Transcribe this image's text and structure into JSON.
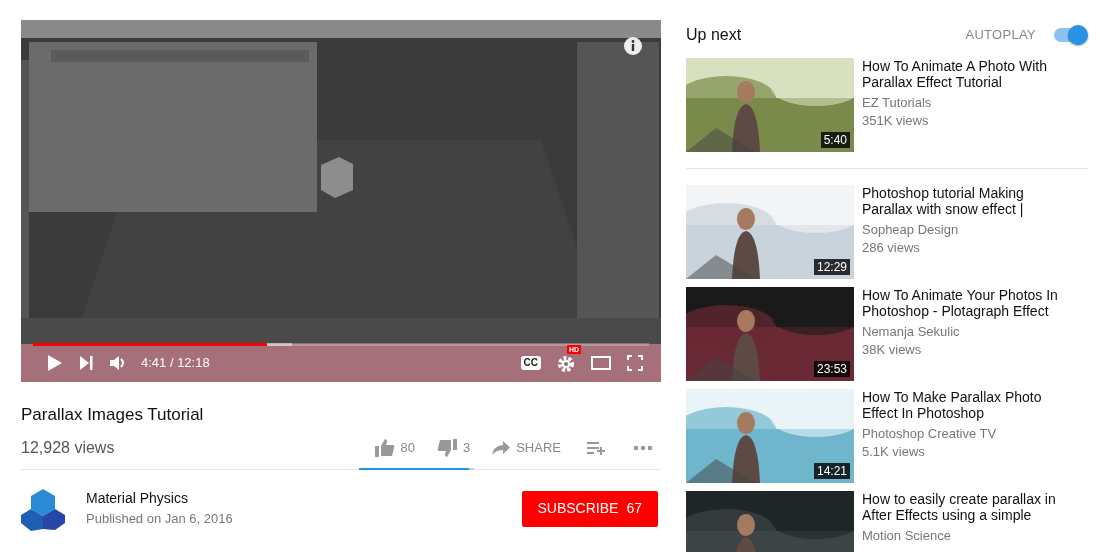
{
  "player": {
    "progress": {
      "level": 0.38
    },
    "buffered": {
      "level": 0.42
    },
    "time": "4:41 / 12:18",
    "captions_label": "CC",
    "quality_badge": "HD"
  },
  "video": {
    "title": "Parallax Images Tutorial",
    "views": "12,928 views",
    "likes": "80",
    "dislikes": "3",
    "like_ratio": {
      "level": 0.96
    },
    "share_label": "SHARE"
  },
  "channel": {
    "name": "Material Physics",
    "published": "Published on Jan 6, 2016",
    "subscribe_label": "SUBSCRIBE",
    "subscriber_count": "67"
  },
  "up_next": {
    "heading": "Up next",
    "autoplay_label": "AUTOPLAY",
    "autoplay_on": true
  },
  "recommendations": [
    {
      "title": "How To Animate A Photo With Parallax Effect Tutorial",
      "channel": "EZ Tutorials",
      "views": "351K views",
      "duration": "5:40",
      "color": "#7a8a4a"
    },
    {
      "title": "Photoshop tutorial Making Parallax with snow effect |",
      "channel": "Sopheap Design",
      "views": "286 views",
      "duration": "12:29",
      "color": "#c9d3dc"
    },
    {
      "title": "How To Animate Your Photos In Photoshop - Plotagraph Effect",
      "channel": "Nemanja Sekulic",
      "views": "38K views",
      "duration": "23:53",
      "color": "#6a2a35"
    },
    {
      "title": "How To Make Parallax Photo Effect In Photoshop",
      "channel": "Photoshop Creative TV",
      "views": "5.1K views",
      "duration": "14:21",
      "color": "#6fb6cc"
    },
    {
      "title": "How to easily create parallax in After Effects using a simple",
      "channel": "Motion Science",
      "color": "#3d4446"
    }
  ]
}
